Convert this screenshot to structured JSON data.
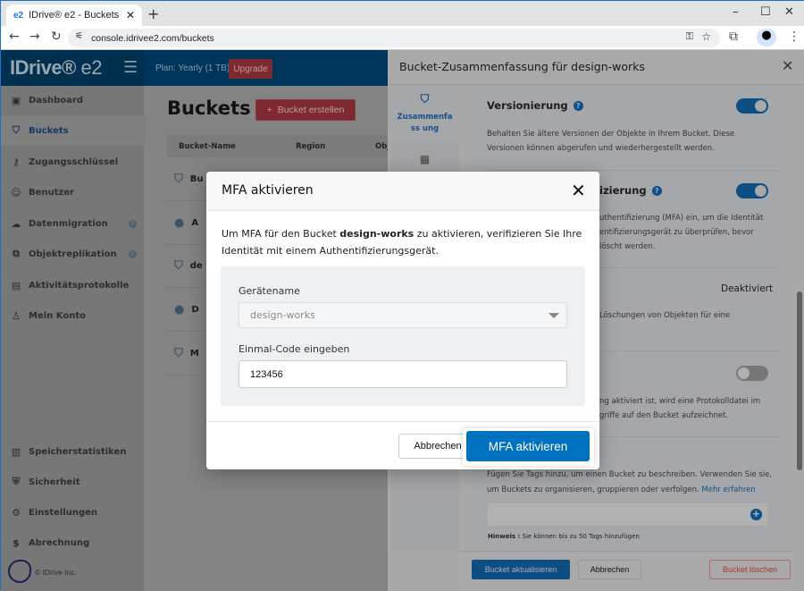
{
  "browser": {
    "tab_title": "IDrive® e2 - Buckets",
    "favicon": "e2",
    "url": "console.idrivee2.com/buckets"
  },
  "header": {
    "logo": "IDrive",
    "logo_suffix": "e2",
    "plan": "Plan: Yearly (1 TB)",
    "upgrade": "Upgrade"
  },
  "sidebar": {
    "items": [
      {
        "label": "Dashboard",
        "icon": "▣"
      },
      {
        "label": "Buckets",
        "icon": "⛉"
      },
      {
        "label": "Zugangsschlüssel",
        "icon": "⚷"
      },
      {
        "label": "Benutzer",
        "icon": "☺"
      },
      {
        "label": "Datenmigration",
        "icon": "☁"
      },
      {
        "label": "Objektreplikation",
        "icon": "⧉"
      },
      {
        "label": "Aktivitätsprotokolle",
        "icon": "▤"
      },
      {
        "label": "Mein Konto",
        "icon": "♙"
      }
    ],
    "bottom": [
      {
        "label": "Speicherstatistiken",
        "icon": "▥"
      },
      {
        "label": "Sicherheit",
        "icon": "⛨"
      },
      {
        "label": "Einstellungen",
        "icon": "⚙"
      },
      {
        "label": "Abrechnung",
        "icon": "$"
      }
    ],
    "help": "?",
    "copyright": "© IDrive Inc."
  },
  "main": {
    "title": "Buckets",
    "create_button": "Bucket erstellen",
    "columns": [
      "Bucket-Name",
      "Region",
      "Obj"
    ],
    "rows": [
      {
        "name": "Bu",
        "icon": "bucket"
      },
      {
        "name": "A",
        "icon": "globe"
      },
      {
        "name": "de",
        "icon": "bucket"
      },
      {
        "name": "D",
        "icon": "globe"
      },
      {
        "name": "M",
        "icon": "bucket"
      }
    ]
  },
  "drawer": {
    "title": "Bucket-Zusammenfassung für design-works",
    "nav": [
      {
        "label": "Zusammenfass ung"
      }
    ],
    "versioning": {
      "title": "Versionierung",
      "enabled": true,
      "desc": "Behalten Sie ältere Versionen der Objekte in Ihrem Bucket. Diese Versionen können abgerufen und wiederhergestellt werden."
    },
    "mfa": {
      "title_fragment": "izierung",
      "enabled": true,
      "desc_lines": [
        "uthentifizierung (MFA) ein, um die Identität",
        "entifizierungsgerät zu überprüfen, bevor",
        "löscht werden."
      ]
    },
    "lock": {
      "status": "Deaktiviert",
      "desc_fragment": "Löschungen von Objekten für eine"
    },
    "logging": {
      "enabled": false,
      "desc_lines": [
        "ng aktiviert ist, wird eine Protokolldatei im",
        "griffe auf den Bucket aufzeichnet."
      ]
    },
    "tags": {
      "desc": "Fügen Sie Tags hinzu, um einen Bucket zu beschreiben. Verwenden Sie sie, um Buckets zu organisieren, gruppieren oder verfolgen.",
      "link": "Mehr erfahren",
      "hint_label": "Hinweis :",
      "hint": "Sie können bis zu 50 Tags hinzufügen"
    },
    "footer": {
      "update": "Bucket aktualisieren",
      "cancel": "Abbrechen",
      "delete": "Bucket löschen"
    }
  },
  "modal": {
    "title": "MFA aktivieren",
    "text_before": "Um MFA für den Bucket ",
    "bucket": "design-works",
    "text_after": " zu aktivieren, verifizieren Sie Ihre Identität mit einem Authentifizierungsgerät.",
    "device_label": "Gerätename",
    "device_value": "design-works",
    "code_label": "Einmal-Code eingeben",
    "code_value": "123456",
    "cancel": "Abbrechen",
    "confirm": "MFA aktivieren"
  }
}
